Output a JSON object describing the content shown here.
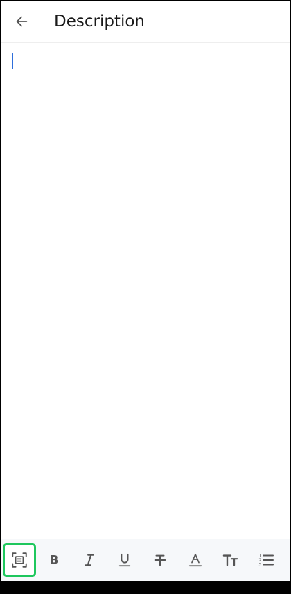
{
  "header": {
    "title": "Description"
  },
  "editor": {
    "text": ""
  },
  "toolbar": {
    "tools": [
      {
        "icon": "scan-text-icon",
        "selected": true
      },
      {
        "icon": "bold-icon",
        "selected": false
      },
      {
        "icon": "italic-icon",
        "selected": false
      },
      {
        "icon": "underline-icon",
        "selected": false
      },
      {
        "icon": "strikethrough-icon",
        "selected": false
      },
      {
        "icon": "text-color-icon",
        "selected": false
      },
      {
        "icon": "text-size-icon",
        "selected": false
      },
      {
        "icon": "numbered-list-icon",
        "selected": false
      }
    ]
  },
  "colors": {
    "caret": "#2f6fdb",
    "selected_outline": "#1ec75d",
    "icon": "#555555"
  }
}
